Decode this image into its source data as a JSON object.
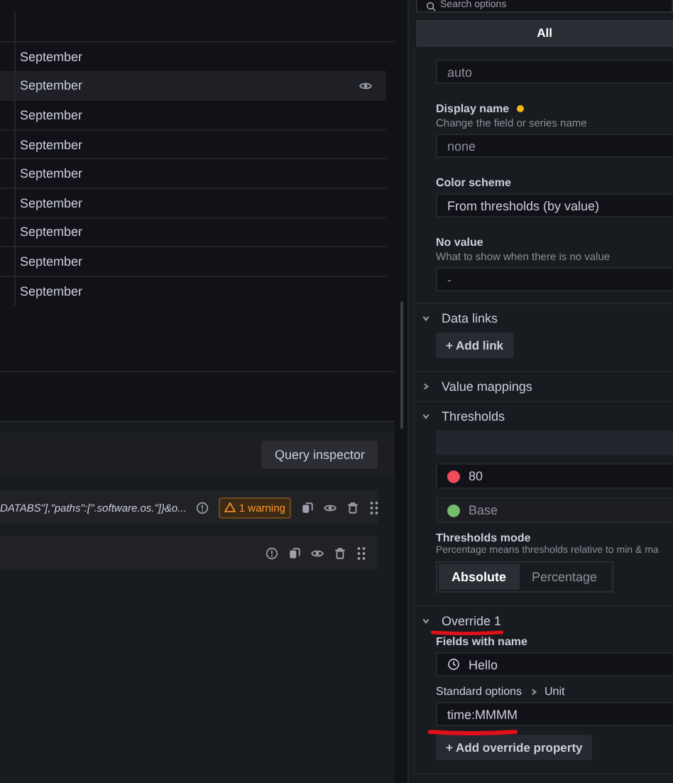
{
  "search": {
    "placeholder": "Search options"
  },
  "category_tabs": [
    {
      "label": "All",
      "selected": true
    }
  ],
  "table": {
    "rows": [
      {
        "cell": "September",
        "hovered": false
      },
      {
        "cell": "September",
        "hovered": true
      },
      {
        "cell": "September",
        "hovered": false
      },
      {
        "cell": "September",
        "hovered": false
      },
      {
        "cell": "September",
        "hovered": false
      },
      {
        "cell": "September",
        "hovered": false
      },
      {
        "cell": "September",
        "hovered": false
      },
      {
        "cell": "September",
        "hovered": false
      },
      {
        "cell": "September",
        "hovered": false
      }
    ]
  },
  "query_editor": {
    "inspector_button": "Query inspector",
    "queries": [
      {
        "kind": "query",
        "text": "DATABS\"],\"paths\":[\".software.os.\"]}&o...",
        "warning": "1 warning"
      },
      {
        "kind": "query"
      }
    ]
  },
  "options": [
    {
      "kind": "input",
      "placeholder": "auto"
    },
    {
      "kind": "field",
      "label": "Display name",
      "modified": true,
      "description": "Change the field or series name",
      "placeholder": "none"
    },
    {
      "kind": "field",
      "label": "Color scheme",
      "value": "From thresholds (by value)"
    },
    {
      "kind": "field",
      "label": "No value",
      "description": "What to show when there is no value",
      "placeholder": "-"
    },
    {
      "kind": "section",
      "title": "Data links",
      "expanded": true,
      "children": [
        {
          "kind": "button",
          "label": "+ Add link"
        }
      ]
    },
    {
      "kind": "section",
      "title": "Value mappings",
      "expanded": false
    },
    {
      "kind": "section",
      "title": "Thresholds",
      "expanded": true,
      "children": [
        {
          "kind": "blank"
        },
        {
          "kind": "threshold",
          "value": "80",
          "color": "#f2495c",
          "base": false
        },
        {
          "kind": "threshold",
          "value": "Base",
          "color": "#73bf69",
          "base": true
        },
        {
          "kind": "radio",
          "label": "Thresholds mode",
          "description": "Percentage means thresholds relative to min & ma",
          "choices": [
            {
              "label": "Absolute",
              "selected": true
            },
            {
              "label": "Percentage",
              "selected": false
            }
          ]
        }
      ]
    },
    {
      "kind": "section",
      "title": "Override 1",
      "expanded": true,
      "underlined": true,
      "children": [
        {
          "kind": "matcher",
          "label": "Fields with name",
          "value": "Hello"
        },
        {
          "kind": "field",
          "path": [
            "Standard options",
            "Unit"
          ],
          "value": "time:MMMM",
          "underlined": true
        },
        {
          "kind": "button",
          "label": "+ Add override property"
        }
      ]
    }
  ]
}
